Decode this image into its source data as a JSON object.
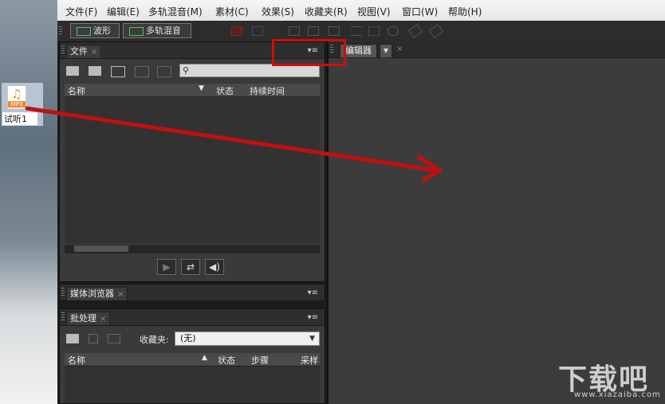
{
  "desktop": {
    "file_icon_tag": "MP3",
    "file_label": "试听1"
  },
  "menu": [
    "文件(F)",
    "编辑(E)",
    "多轨混音(M)",
    "素材(C)",
    "效果(S)",
    "收藏夹(R)",
    "视图(V)",
    "窗口(W)",
    "帮助(H)"
  ],
  "toolbar": {
    "waveform_label": "波形",
    "multitrack_label": "多轨混音"
  },
  "files_panel": {
    "tab": "文件",
    "columns": [
      "名称",
      "状态",
      "持续时间"
    ]
  },
  "media_browser": {
    "tab": "媒体浏览器"
  },
  "batch_panel": {
    "tab": "批处理",
    "favorites_label": "收藏夹:",
    "favorites_value": "(无)",
    "columns": [
      "名称",
      "状态",
      "步骤",
      "采样"
    ]
  },
  "editor": {
    "tab": "编辑器"
  },
  "watermark": {
    "main": "下载吧",
    "sub": "www.xiazaiba.com"
  },
  "colors": {
    "highlight": "#d10c0c",
    "panel_bg": "#3a3a3a",
    "menubar_bg": "#eeeeee"
  }
}
